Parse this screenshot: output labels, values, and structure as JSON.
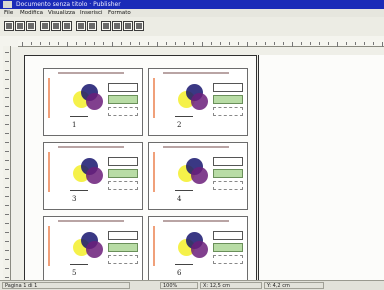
{
  "window": {
    "title": "Documento senza titolo · Publisher",
    "accent": "#1a2bb8"
  },
  "menu": [
    "File",
    "Modifica",
    "Visualizza",
    "Inserisci",
    "Formato",
    "Strumenti",
    "?"
  ],
  "toolbar": {
    "buttons": [
      "new-icon",
      "open-icon",
      "save-icon",
      "print-icon",
      "copy-icon",
      "paste-icon",
      "zoom-in-icon",
      "zoom-out-icon",
      "align-left-icon",
      "align-center-icon",
      "align-right-icon",
      "frame-icon"
    ]
  },
  "cards": [
    {
      "number": "1"
    },
    {
      "number": "2"
    },
    {
      "number": "3"
    },
    {
      "number": "4"
    },
    {
      "number": "5"
    },
    {
      "number": "6"
    }
  ],
  "colors": {
    "venn_yellow": "#f3ef2a",
    "venn_navy": "#17156e",
    "venn_purple": "#6b1f7a",
    "field_green": "#b8dca5",
    "side_label": "#f0a07a"
  },
  "status": {
    "panels": [
      "Pagina 1 di 1",
      "100%",
      "X: 12,5 cm",
      "Y: 4,2 cm"
    ]
  }
}
